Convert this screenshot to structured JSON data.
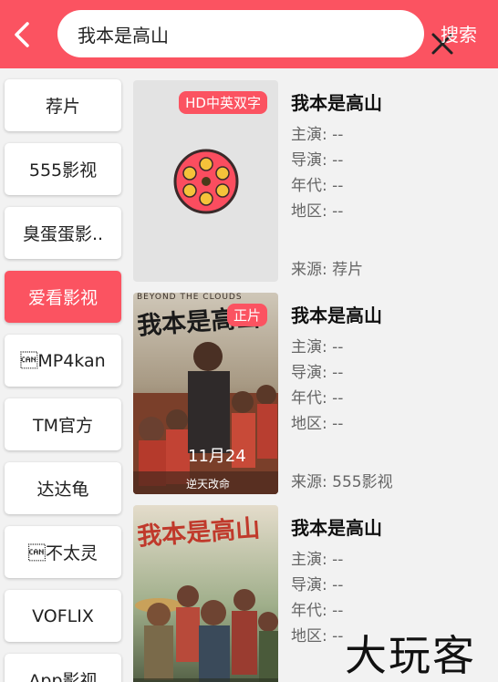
{
  "topbar": {
    "search_value": "我本是高山",
    "search_button_label": "搜索",
    "color": "#fb5361"
  },
  "sidebar": {
    "items": [
      {
        "label": "荐片",
        "active": false
      },
      {
        "label": "555影视",
        "active": false
      },
      {
        "label": "臭蛋蛋影..",
        "active": false
      },
      {
        "label": "爱看影视",
        "active": true
      },
      {
        "label": "\u0018MP4kan",
        "active": false
      },
      {
        "label": "TM官方",
        "active": false
      },
      {
        "label": "达达龟",
        "active": false
      },
      {
        "label": "\u0018不太灵",
        "active": false
      },
      {
        "label": "VOFLIX",
        "active": false
      },
      {
        "label": "App影视",
        "active": false
      }
    ]
  },
  "results": [
    {
      "title": "我本是高山",
      "badge": "HD中英双字",
      "poster_icon": "film-reel-icon",
      "actors_label": "主演:",
      "actors": "--",
      "director_label": "导演:",
      "director": "--",
      "year_label": "年代:",
      "year": "--",
      "region_label": "地区:",
      "region": "--",
      "source_label": "来源:",
      "source": "荐片"
    },
    {
      "title": "我本是高山",
      "badge": "正片",
      "poster_art": {
        "title": "我本是高山",
        "english": "BEYOND THE CLOUDS",
        "date": "11月24",
        "slogan": "逆天改命"
      },
      "actors_label": "主演:",
      "actors": "--",
      "director_label": "导演:",
      "director": "--",
      "year_label": "年代:",
      "year": "--",
      "region_label": "地区:",
      "region": "--",
      "source_label": "来源:",
      "source": "555影视"
    },
    {
      "title": "我本是高山",
      "poster_art": {
        "title": "我本是高山"
      },
      "actors_label": "主演:",
      "actors": "--",
      "director_label": "导演:",
      "director": "--",
      "year_label": "年代:",
      "year": "--",
      "region_label": "地区:",
      "region": "--"
    }
  ],
  "watermark": "大玩客"
}
